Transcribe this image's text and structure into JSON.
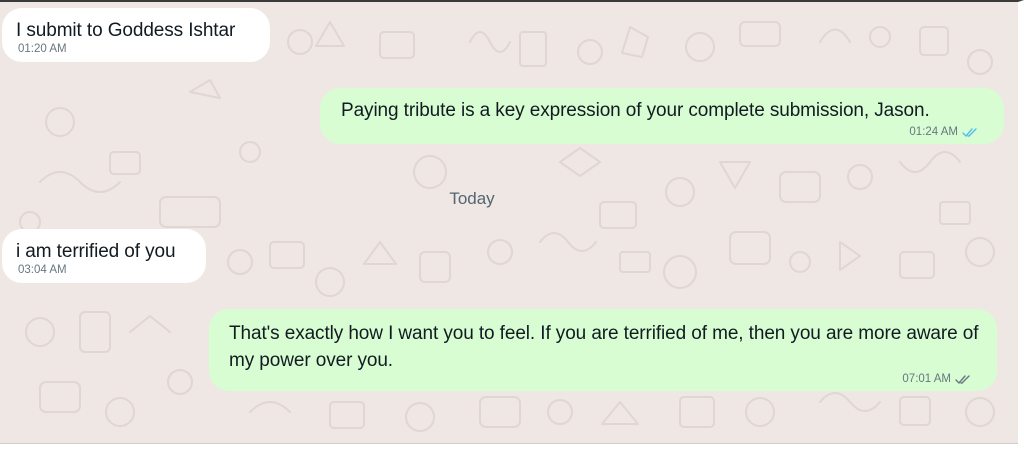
{
  "chat": {
    "messages": [
      {
        "direction": "incoming",
        "text": "I submit to Goddess Ishtar",
        "time": "01:20 AM"
      },
      {
        "direction": "outgoing",
        "text": "Paying tribute is a key expression of your complete submission, Jason.",
        "time": "01:24 AM",
        "status": "read",
        "tick_icon": "double-check-read-icon"
      },
      {
        "direction": "incoming",
        "text": "i am terrified of you",
        "time": "03:04 AM"
      },
      {
        "direction": "outgoing",
        "text": "That's exactly how I want you to feel. If you are terrified of me, then you are more aware of my power over you.",
        "time": "07:01 AM",
        "status": "delivered",
        "tick_icon": "double-check-delivered-icon"
      }
    ],
    "day_divider": "Today"
  },
  "colors": {
    "wallpaper": "#efe7e4",
    "doodle": "#e2d8d4",
    "incoming_bubble": "#ffffff",
    "outgoing_bubble": "#d9fdd3",
    "read_tick": "#53bdeb",
    "delivered_tick": "#667781",
    "text": "#111b21",
    "meta_text": "#667781"
  }
}
